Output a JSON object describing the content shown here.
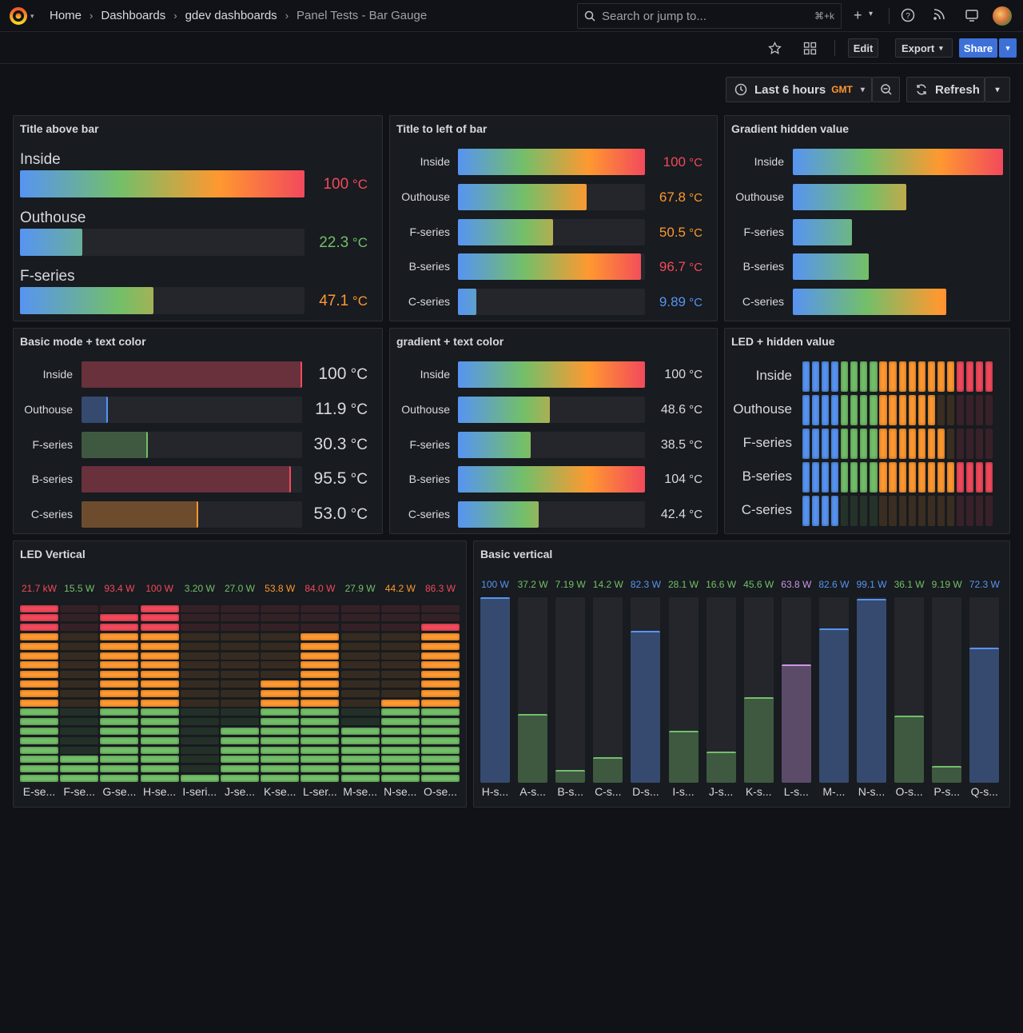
{
  "nav": {
    "breadcrumb": [
      "Home",
      "Dashboards",
      "gdev dashboards",
      "Panel Tests - Bar Gauge"
    ],
    "search_placeholder": "Search or jump to...",
    "search_shortcut": "⌘+k"
  },
  "toolbar": {
    "edit_label": "Edit",
    "export_label": "Export",
    "share_label": "Share"
  },
  "time_controls": {
    "range_label": "Last 6 hours",
    "timezone": "GMT",
    "refresh_label": "Refresh"
  },
  "colors": {
    "blue": "#5794f2",
    "green": "#73bf69",
    "orange": "#ff9830",
    "red": "#f2495c",
    "purple": "#ca95e5"
  },
  "panels": [
    {
      "id": "title-above",
      "title": "Title above bar",
      "rows": [
        {
          "label": "Inside",
          "value": "100",
          "unit": "°C",
          "fraction": 1.0,
          "color": "#f2495c"
        },
        {
          "label": "Outhouse",
          "value": "22.3",
          "unit": "°C",
          "fraction": 0.22,
          "color": "#73bf69"
        },
        {
          "label": "F-series",
          "value": "47.1",
          "unit": "°C",
          "fraction": 0.47,
          "color": "#ff9830"
        }
      ]
    },
    {
      "id": "title-left",
      "title": "Title to left of bar",
      "rows": [
        {
          "label": "Inside",
          "value": "100",
          "unit": "°C",
          "fraction": 1.0,
          "color": "#f2495c"
        },
        {
          "label": "Outhouse",
          "value": "67.8",
          "unit": "°C",
          "fraction": 0.69,
          "color": "#ff9830"
        },
        {
          "label": "F-series",
          "value": "50.5",
          "unit": "°C",
          "fraction": 0.51,
          "color": "#ff9830"
        },
        {
          "label": "B-series",
          "value": "96.7",
          "unit": "°C",
          "fraction": 0.98,
          "color": "#f2495c"
        },
        {
          "label": "C-series",
          "value": "9.89",
          "unit": "°C",
          "fraction": 0.1,
          "color": "#5794f2"
        }
      ]
    },
    {
      "id": "gradient-hidden",
      "title": "Gradient hidden value",
      "rows": [
        {
          "label": "Inside",
          "fraction": 1.0
        },
        {
          "label": "Outhouse",
          "fraction": 0.54
        },
        {
          "label": "F-series",
          "fraction": 0.28
        },
        {
          "label": "B-series",
          "fraction": 0.36
        },
        {
          "label": "C-series",
          "fraction": 0.73
        }
      ]
    },
    {
      "id": "basic-text",
      "title": "Basic mode + text color",
      "rows": [
        {
          "label": "Inside",
          "value": "100",
          "unit": "°C",
          "fraction": 1.0,
          "color": "#f2495c"
        },
        {
          "label": "Outhouse",
          "value": "11.9",
          "unit": "°C",
          "fraction": 0.12,
          "color": "#5794f2"
        },
        {
          "label": "F-series",
          "value": "30.3",
          "unit": "°C",
          "fraction": 0.3,
          "color": "#73bf69"
        },
        {
          "label": "B-series",
          "value": "95.5",
          "unit": "°C",
          "fraction": 0.95,
          "color": "#f2495c"
        },
        {
          "label": "C-series",
          "value": "53.0",
          "unit": "°C",
          "fraction": 0.53,
          "color": "#ff9830"
        }
      ]
    },
    {
      "id": "gradient-text",
      "title": "gradient + text color",
      "rows": [
        {
          "label": "Inside",
          "value": "100",
          "unit": "°C",
          "fraction": 1.0
        },
        {
          "label": "Outhouse",
          "value": "48.6",
          "unit": "°C",
          "fraction": 0.49
        },
        {
          "label": "F-series",
          "value": "38.5",
          "unit": "°C",
          "fraction": 0.39
        },
        {
          "label": "B-series",
          "value": "104",
          "unit": "°C",
          "fraction": 1.0
        },
        {
          "label": "C-series",
          "value": "42.4",
          "unit": "°C",
          "fraction": 0.43
        }
      ]
    },
    {
      "id": "led-hidden",
      "title": "LED + hidden value",
      "rows": [
        {
          "label": "Inside",
          "lit": 20
        },
        {
          "label": "Outhouse",
          "lit": 14
        },
        {
          "label": "F-series",
          "lit": 15
        },
        {
          "label": "B-series",
          "lit": 20
        },
        {
          "label": "C-series",
          "lit": 4
        }
      ]
    },
    {
      "id": "led-vertical",
      "title": "LED Vertical",
      "columns": [
        {
          "label": "E-se...",
          "value": "21.7 kW",
          "lit": 19,
          "color": "#f2495c"
        },
        {
          "label": "F-se...",
          "value": "15.5 W",
          "lit": 3,
          "color": "#73bf69"
        },
        {
          "label": "G-se...",
          "value": "93.4 W",
          "lit": 18,
          "color": "#f2495c"
        },
        {
          "label": "H-se...",
          "value": "100 W",
          "lit": 19,
          "color": "#f2495c"
        },
        {
          "label": "I-seri...",
          "value": "3.20 W",
          "lit": 1,
          "color": "#73bf69"
        },
        {
          "label": "J-se...",
          "value": "27.0 W",
          "lit": 6,
          "color": "#73bf69"
        },
        {
          "label": "K-se...",
          "value": "53.8 W",
          "lit": 11,
          "color": "#ff9830"
        },
        {
          "label": "L-ser...",
          "value": "84.0 W",
          "lit": 16,
          "color": "#f2495c"
        },
        {
          "label": "M-se...",
          "value": "27.9 W",
          "lit": 6,
          "color": "#73bf69"
        },
        {
          "label": "N-se...",
          "value": "44.2 W",
          "lit": 9,
          "color": "#ff9830"
        },
        {
          "label": "O-se...",
          "value": "86.3 W",
          "lit": 17,
          "color": "#f2495c"
        }
      ]
    },
    {
      "id": "basic-vertical",
      "title": "Basic vertical",
      "columns": [
        {
          "label": "H-s...",
          "value": "100 W",
          "fraction": 1.0,
          "color": "#5794f2"
        },
        {
          "label": "A-s...",
          "value": "37.2 W",
          "fraction": 0.37,
          "color": "#73bf69"
        },
        {
          "label": "B-s...",
          "value": "7.19 W",
          "fraction": 0.07,
          "color": "#73bf69"
        },
        {
          "label": "C-s...",
          "value": "14.2 W",
          "fraction": 0.14,
          "color": "#73bf69"
        },
        {
          "label": "D-s...",
          "value": "82.3 W",
          "fraction": 0.82,
          "color": "#5794f2"
        },
        {
          "label": "I-s...",
          "value": "28.1 W",
          "fraction": 0.28,
          "color": "#73bf69"
        },
        {
          "label": "J-s...",
          "value": "16.6 W",
          "fraction": 0.17,
          "color": "#73bf69"
        },
        {
          "label": "K-s...",
          "value": "45.6 W",
          "fraction": 0.46,
          "color": "#73bf69"
        },
        {
          "label": "L-s...",
          "value": "63.8 W",
          "fraction": 0.64,
          "color": "#ca95e5"
        },
        {
          "label": "M-...",
          "value": "82.6 W",
          "fraction": 0.83,
          "color": "#5794f2"
        },
        {
          "label": "N-s...",
          "value": "99.1 W",
          "fraction": 0.99,
          "color": "#5794f2"
        },
        {
          "label": "O-s...",
          "value": "36.1 W",
          "fraction": 0.36,
          "color": "#73bf69"
        },
        {
          "label": "P-s...",
          "value": "9.19 W",
          "fraction": 0.09,
          "color": "#73bf69"
        },
        {
          "label": "Q-s...",
          "value": "72.3 W",
          "fraction": 0.73,
          "color": "#5794f2"
        }
      ]
    }
  ]
}
